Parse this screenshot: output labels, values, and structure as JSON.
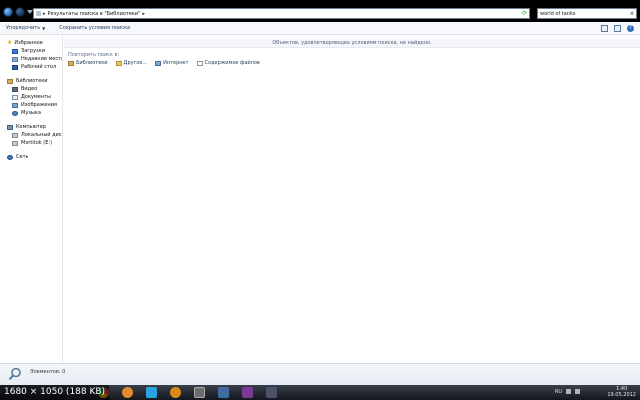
{
  "address_bar": {
    "breadcrumb_arrow": "▸",
    "path": "Результаты поиска в \"Библиотеки\"",
    "end_arrow": "▸"
  },
  "search": {
    "value": "world of tanks",
    "clear": "×"
  },
  "toolbar": {
    "organize": "Упорядочить",
    "save_search": "Сохранить условия поиска"
  },
  "sidebar": {
    "favorites": {
      "label": "Избранное",
      "items": [
        "Загрузки",
        "Недавние места",
        "Рабочий стол"
      ]
    },
    "libraries": {
      "label": "Библиотеки",
      "items": [
        "Видео",
        "Документы",
        "Изображения",
        "Музыка"
      ]
    },
    "computer": {
      "label": "Компьютер",
      "items": [
        "Локальный диск (C:)",
        "Mortitok (E:)"
      ]
    },
    "network": {
      "label": "Сеть"
    }
  },
  "main": {
    "no_results": "Объектов, удовлетворяющих условиям поиска, не найдено.",
    "search_again_label": "Повторить поиск в:",
    "search_again_items": [
      "Библиотеки",
      "Другое...",
      "Интернет",
      "Содержимое файлов"
    ]
  },
  "details": {
    "text": "Элементов: 0"
  },
  "taskbar": {
    "overlay_label": "1680 × 1050 (188 KB)",
    "time": "1:40",
    "date": "19.05.2012",
    "lang": "RU"
  },
  "colors": {
    "titlebar": "#000000",
    "toolbar_text": "#1e395b",
    "no_results_text": "#4c607a"
  }
}
